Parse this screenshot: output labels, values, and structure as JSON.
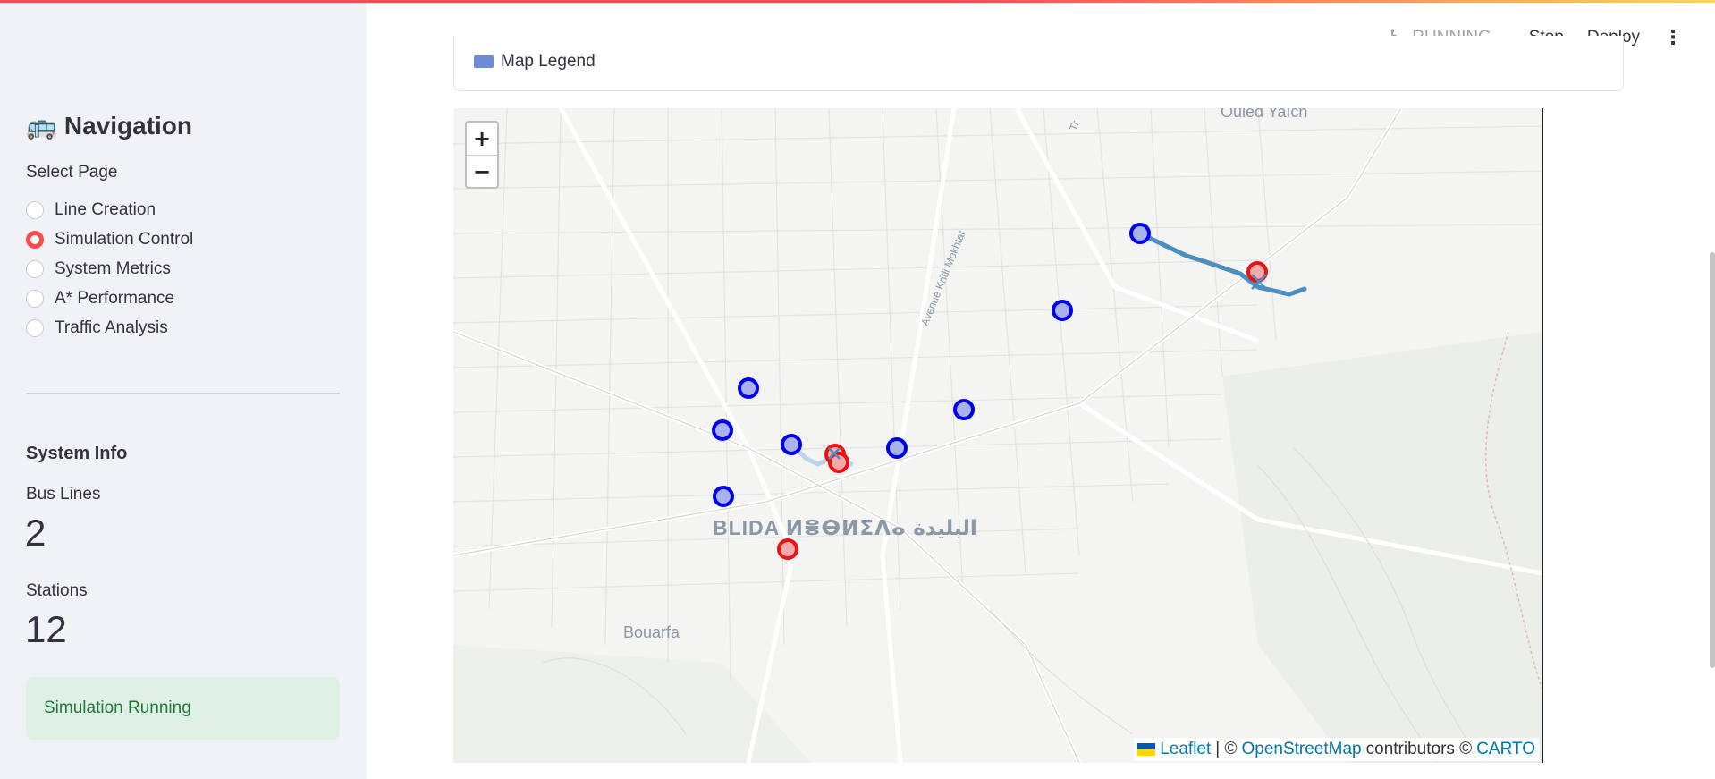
{
  "sidebar": {
    "nav_title": "Navigation",
    "bus_emoji": "🚌",
    "select_label": "Select Page",
    "pages": [
      {
        "label": "Line Creation",
        "selected": false
      },
      {
        "label": "Simulation Control",
        "selected": true
      },
      {
        "label": "System Metrics",
        "selected": false
      },
      {
        "label": "A* Performance",
        "selected": false
      },
      {
        "label": "Traffic Analysis",
        "selected": false
      }
    ],
    "system_info_title": "System Info",
    "metrics": {
      "bus_lines_label": "Bus Lines",
      "bus_lines_value": "2",
      "stations_label": "Stations",
      "stations_value": "12"
    },
    "status": "Simulation Running"
  },
  "header": {
    "running_text": "RUNNING...",
    "running_icon": "running-man-icon",
    "stop_label": "Stop",
    "deploy_label": "Deploy",
    "menu_icon": "kebab-menu-icon"
  },
  "main": {
    "legend_label": "Map Legend",
    "map": {
      "zoom_in": "+",
      "zoom_out": "−",
      "places": {
        "city": "BLIDA ⵍⴻⴱⵍⵉⴷⴰ البليدة",
        "district_1": "Bouarfa",
        "district_2": "Ouled Yaïch",
        "street": "Avenue Kritli Mokhtar",
        "street_2": "Tr"
      },
      "attribution": {
        "leaflet": "Leaflet",
        "sep1": "| ©",
        "osm": "OpenStreetMap",
        "contributors": "contributors ©",
        "carto": "CARTO"
      }
    }
  },
  "colors": {
    "accent": "#ff4b4b",
    "station_blue": "#0000ee",
    "station_red": "#ee1111",
    "route": "#4a8ec2",
    "success_bg": "#dff0e5",
    "success_text": "#1e7a3a"
  }
}
